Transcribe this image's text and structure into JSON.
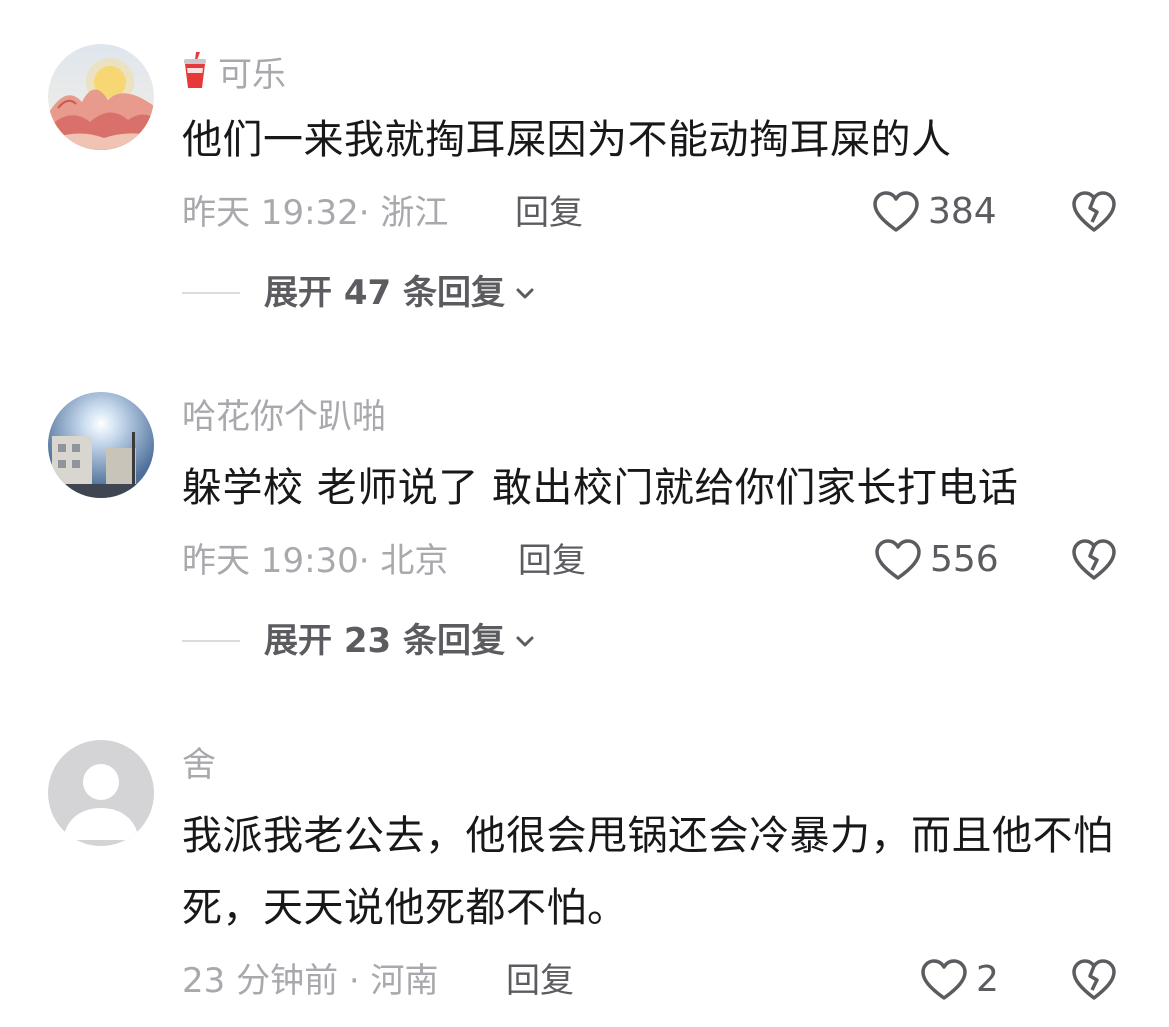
{
  "comments": [
    {
      "username": "可乐",
      "username_icon": "soda-cup-icon",
      "text": "他们一来我就掏耳屎因为不能动掏耳屎的人",
      "meta": "昨天 19:32· 浙江",
      "reply_label": "回复",
      "likes": "384",
      "expand_label": "展开 47 条回复"
    },
    {
      "username": "哈花你个趴啪",
      "text": "躲学校 老师说了 敢出校门就给你们家长打电话",
      "meta": "昨天 19:30· 北京",
      "reply_label": "回复",
      "likes": "556",
      "expand_label": "展开 23 条回复"
    },
    {
      "username": "舍",
      "text": "我派我老公去，他很会甩锅还会冷暴力，而且他不怕死，天天说他死都不怕。",
      "meta": "23 分钟前 · 河南",
      "reply_label": "回复",
      "likes": "2"
    }
  ],
  "icons": {
    "like": "heart-outline-icon",
    "dislike": "broken-heart-icon",
    "expand": "chevron-down-icon"
  },
  "colors": {
    "text_primary": "#18181b",
    "text_secondary": "#a8a8ad",
    "action_text": "#5b5b60",
    "cup_red": "#e63a3a"
  }
}
